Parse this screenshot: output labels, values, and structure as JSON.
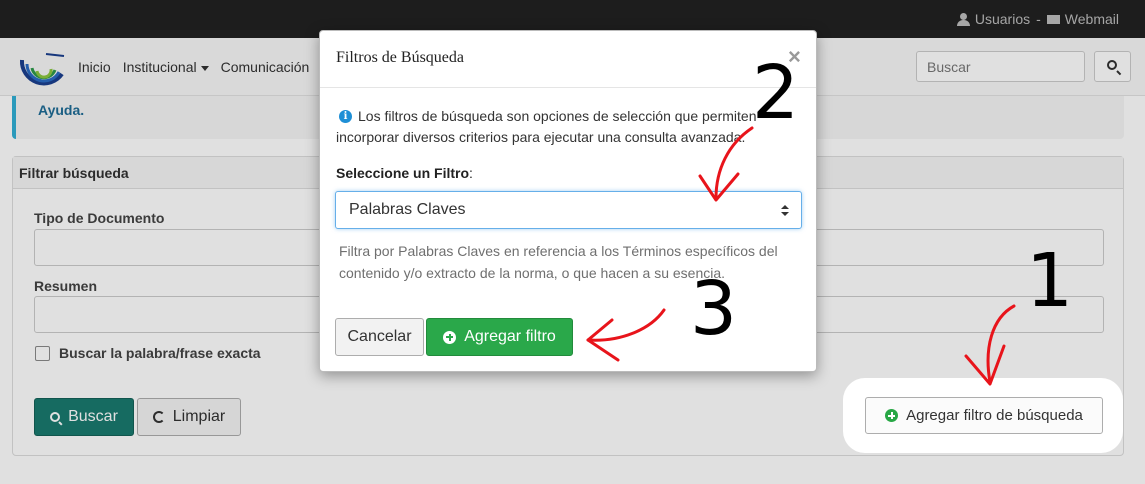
{
  "topbar": {
    "users_label": "Usuarios",
    "separator": "-",
    "webmail_label": "Webmail"
  },
  "nav": {
    "items": [
      {
        "label": "Inicio",
        "dropdown": false
      },
      {
        "label": "Institucional",
        "dropdown": true
      },
      {
        "label": "Comunicación",
        "dropdown": false
      }
    ],
    "search_placeholder": "Buscar"
  },
  "help_alert": {
    "text": "Ayuda."
  },
  "filter_panel": {
    "title": "Filtrar búsqueda",
    "fields": [
      {
        "label": "Tipo de Documento"
      },
      {
        "label": "Resumen"
      }
    ],
    "exact_phrase_label": "Buscar la palabra/frase exacta",
    "search_button": "Buscar",
    "clear_button": "Limpiar",
    "add_filter_button": "Agregar filtro de búsqueda"
  },
  "modal": {
    "title": "Filtros de Búsqueda",
    "close_glyph": "×",
    "info_text": "Los filtros de búsqueda son opciones de selección que permiten incorporar diversos criterios para ejecutar una consulta avanzada.",
    "select_label": "Seleccione un Filtro",
    "select_label_suffix": ":",
    "select_value": "Palabras Claves",
    "help_text": "Filtra por Palabras Claves en referencia a los Términos específicos del contenido y/o extracto de la norma, o que hacen a su esencia.",
    "cancel_button": "Cancelar",
    "add_button": "Agregar filtro"
  },
  "annotations": {
    "step1": "1",
    "step2": "2",
    "step3": "3",
    "arrow_color": "#e8141b"
  },
  "colors": {
    "topbar_bg": "#222222",
    "primary_teal": "#1a7a6f",
    "success_green": "#2aa84a",
    "info_blue": "#31b0d5"
  }
}
